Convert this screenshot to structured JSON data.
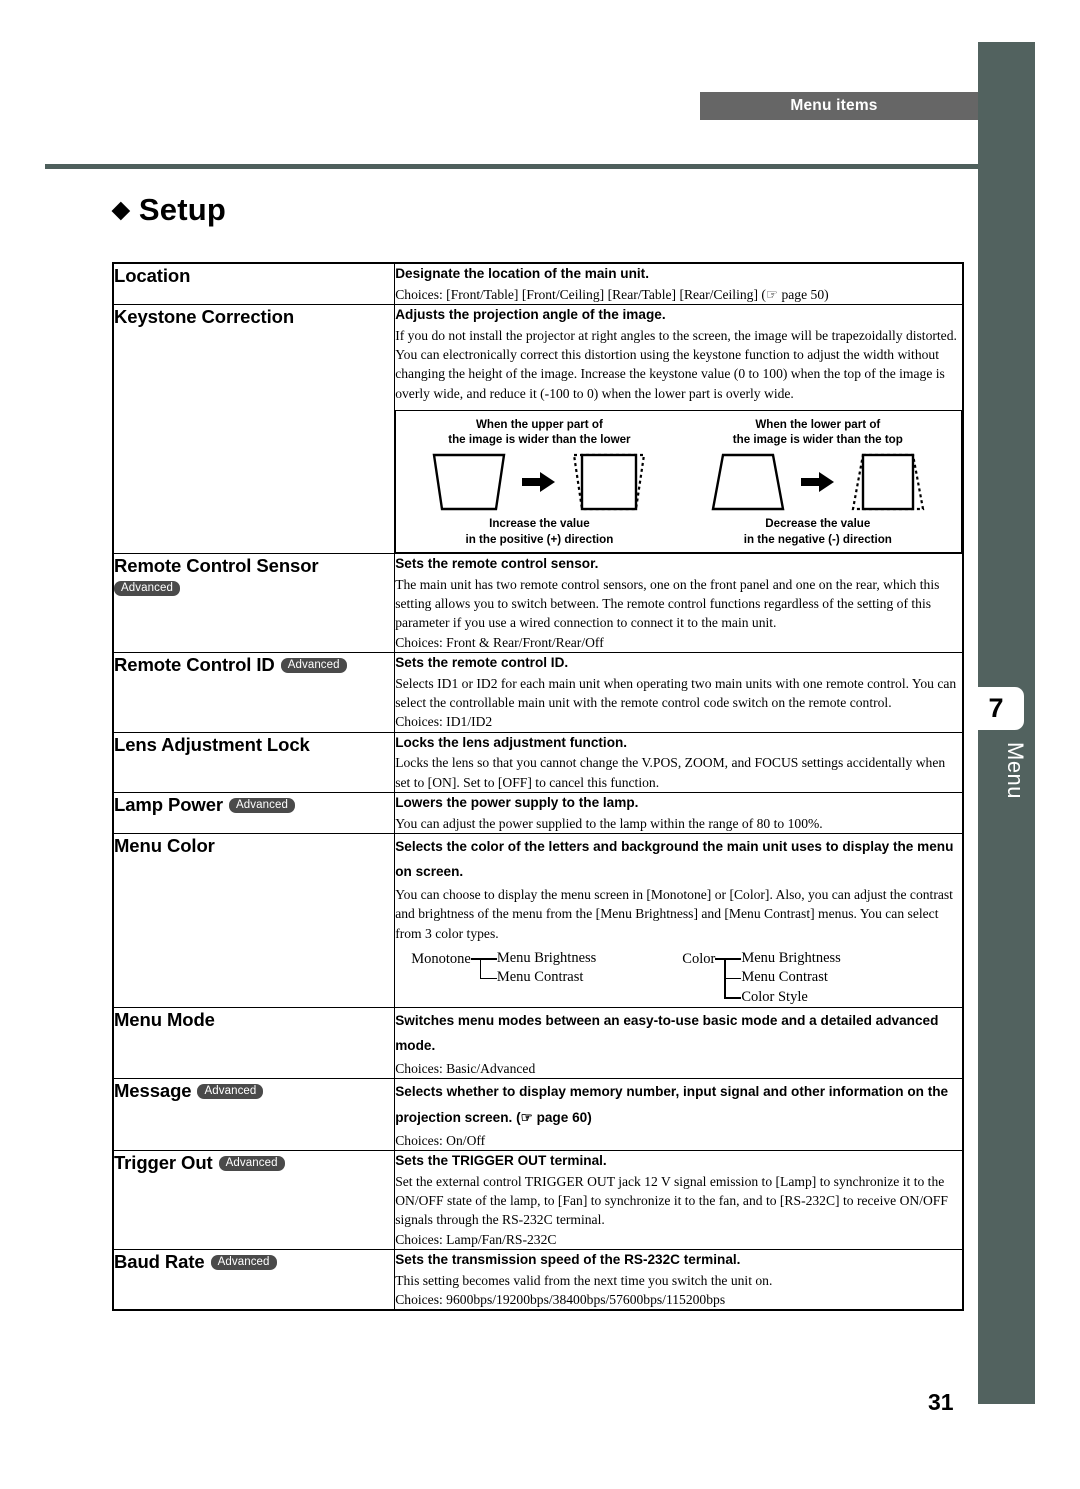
{
  "header": {
    "tab_label": "Menu items"
  },
  "sidebar": {
    "chapter_number": "7",
    "chapter_label": "Menu"
  },
  "page": {
    "title": "Setup",
    "title_bullet": "◆",
    "page_number": "31"
  },
  "badge_label": "Advanced",
  "table": {
    "rows": [
      {
        "name": "Location",
        "badge": "none",
        "heading": "Designate the location of the main unit.",
        "body": [
          "Choices: [Front/Table] [Front/Ceiling] [Rear/Table] [Rear/Ceiling] (☞ page 50)"
        ]
      },
      {
        "name": "Keystone Correction",
        "badge": "none",
        "heading": "Adjusts the projection angle of the image.",
        "body": [
          "If you do not install the projector at right angles to the screen, the image will be trapezoidally distorted. You can electronically correct this distortion using the keystone function to adjust the width without changing the height of the image. Increase the keystone value (0 to 100) when the top of the image is overly wide, and reduce it (-100 to 0) when the lower part is overly wide."
        ],
        "figure": {
          "left": {
            "caption_top": "When the upper part of\nthe image is wider than the lower",
            "caption_top_l1": "When the upper part of",
            "caption_top_l2": "the image is wider than the lower",
            "caption_bottom_l1": "Increase the value",
            "caption_bottom_l2": "in the positive (+) direction"
          },
          "right": {
            "caption_top_l1": "When the lower part of",
            "caption_top_l2": "the image is wider than the top",
            "caption_bottom_l1": "Decrease the value",
            "caption_bottom_l2": "in the negative (-) direction"
          }
        }
      },
      {
        "name": "Remote Control Sensor",
        "badge": "below",
        "heading": "Sets the remote control sensor.",
        "body": [
          "The main unit has two remote control sensors, one on the front panel and one on the rear, which this setting allows you to switch between.  The remote control functions regardless of the setting of this parameter if you use a wired connection to connect it to the main unit.",
          "Choices: Front & Rear/Front/Rear/Off"
        ]
      },
      {
        "name": "Remote Control ID",
        "badge": "inline",
        "heading": "Sets the remote control ID.",
        "body": [
          "Selects ID1 or ID2 for each main unit when operating two main units with one remote control. You can select the controllable main unit with the remote control code switch on the remote control.",
          "Choices: ID1/ID2"
        ]
      },
      {
        "name": "Lens Adjustment Lock",
        "badge": "none",
        "heading": "Locks the lens adjustment function.",
        "body": [
          "Locks the lens so that you cannot change the V.POS, ZOOM, and FOCUS settings accidentally when set to [ON]. Set to [OFF] to cancel this function."
        ]
      },
      {
        "name": "Lamp Power",
        "badge": "inline",
        "heading": "Lowers the power supply to the lamp.",
        "body": [
          "You can adjust the power supplied to the lamp within the range of 80 to 100%."
        ]
      },
      {
        "name": "Menu Color",
        "badge": "none",
        "heading": "Selects the color of the letters and background the main unit uses to display the menu on screen.",
        "body": [
          "You can choose to display the menu screen in [Monotone] or [Color]. Also, you can adjust the contrast and brightness of the menu from the [Menu Brightness] and [Menu Contrast] menus. You can select from 3 color types."
        ],
        "tree": [
          {
            "root": "Monotone",
            "children": [
              "Menu Brightness",
              "Menu Contrast"
            ]
          },
          {
            "root": "Color",
            "children": [
              "Menu Brightness",
              "Menu Contrast",
              "Color Style"
            ]
          }
        ]
      },
      {
        "name": "Menu Mode",
        "badge": "none",
        "heading": "Switches menu modes between an easy-to-use basic mode and a detailed advanced mode.",
        "body": [
          "Choices: Basic/Advanced"
        ]
      },
      {
        "name": "Message",
        "badge": "inline",
        "heading": "Selects whether to display memory number, input signal and other information on the projection screen. (☞ page 60)",
        "body": [
          "Choices: On/Off"
        ]
      },
      {
        "name": "Trigger Out",
        "badge": "inline",
        "heading": "Sets the TRIGGER OUT terminal.",
        "body": [
          "Set the external control TRIGGER OUT jack 12 V signal emission to [Lamp] to synchronize it to the ON/OFF state of the lamp, to [Fan] to synchronize it to the fan, and to [RS-232C] to receive ON/OFF signals through the RS-232C terminal.",
          "Choices: Lamp/Fan/RS-232C"
        ]
      },
      {
        "name": "Baud Rate",
        "badge": "inline",
        "heading": "Sets the transmission speed of the RS-232C terminal.",
        "body": [
          "This setting becomes valid from the next time you switch the unit on.",
          "Choices: 9600bps/19200bps/38400bps/57600bps/115200bps"
        ]
      }
    ]
  },
  "colors": {
    "sidebar": "#52625f",
    "header_tab": "#666666",
    "rule": "#4e5f5c",
    "badge": "#4a4a4a"
  }
}
